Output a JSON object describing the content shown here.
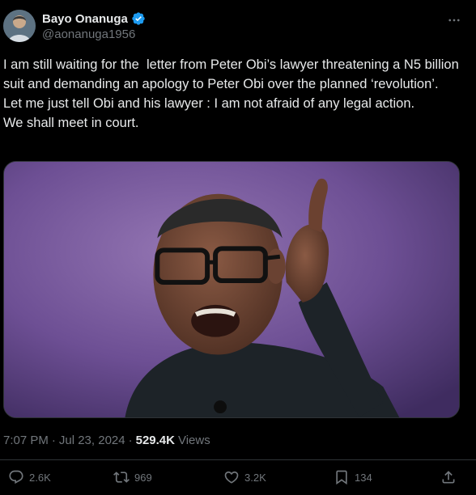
{
  "author": {
    "display_name": "Bayo Onanuga",
    "handle": "@aonanuga1956",
    "verified": true,
    "avatar_icon": "avatar-photo"
  },
  "tweet": {
    "text_lines": [
      "I am still waiting for the  letter from Peter Obi’s lawyer threatening a N5 billion suit and demanding an apology to Peter Obi over the planned ‘revolution’.",
      "Let me just tell Obi and his lawyer : I am not afraid of any legal action.",
      "We shall meet in court."
    ],
    "media_alt_icon": "photo-man-pointing-finger",
    "time": "7:07 PM",
    "separator": "·",
    "date": "Jul 23, 2024",
    "views_count": "529.4K",
    "views_label": "Views"
  },
  "actions": {
    "reply_count": "2.6K",
    "repost_count": "969",
    "like_count": "3.2K",
    "bookmark_count": "134"
  },
  "colors": {
    "background": "#000000",
    "text": "#e7e9ea",
    "muted": "#71767b",
    "verified_blue": "#1d9bf0",
    "divider": "#2f3336"
  }
}
